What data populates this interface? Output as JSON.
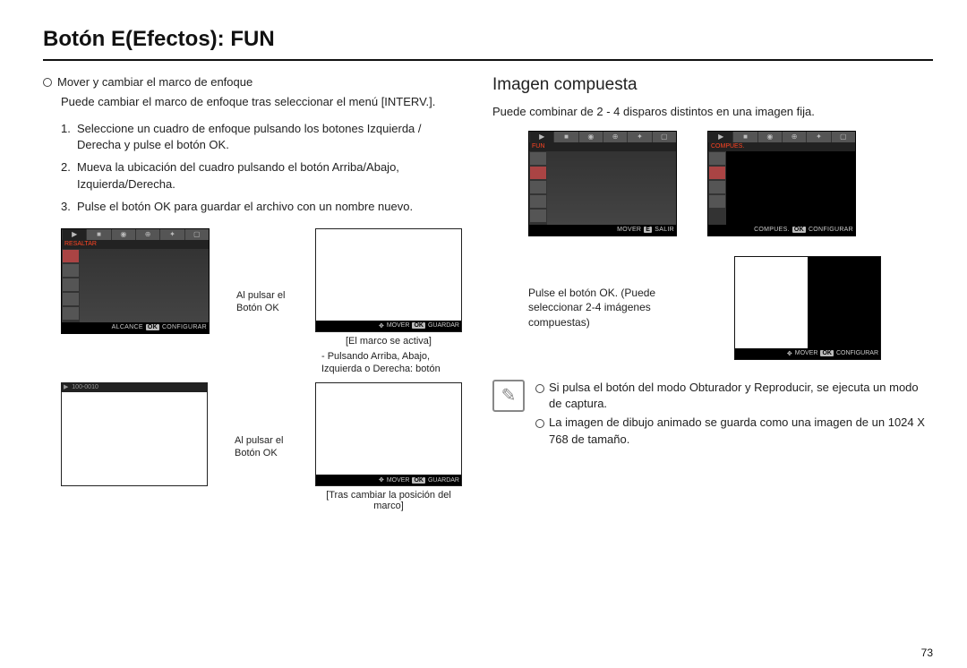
{
  "page": {
    "title": "Botón E(Efectos): FUN",
    "number": "73"
  },
  "left": {
    "lead": "Mover y cambiar el marco de enfoque",
    "lead_sub": "Puede cambiar el marco de enfoque tras seleccionar el menú [INTERV.].",
    "steps": [
      "Seleccione un cuadro de enfoque pulsando los botones Izquierda / Derecha y pulse el botón OK.",
      "Mueva la ubicación del cuadro pulsando el botón Arriba/Abajo, Izquierda/Derecha.",
      "Pulse el botón OK para guardar el archivo con un nombre nuevo."
    ],
    "menu1": {
      "label": "RESALTAR",
      "foot_left": "ALCANCE",
      "foot_key": "OK",
      "foot_right": "CONFIGURAR"
    },
    "cap_mid1": "Al pulsar el Botón OK",
    "preview1": {
      "foot_nav": "MOVER",
      "foot_key": "OK",
      "foot_right": "GUARDAR"
    },
    "cap_under1": "[El marco se activa]",
    "cap_list": "- Pulsando Arriba, Abajo, Izquierda o Derecha: botón",
    "preview2": {
      "top": "100-0010",
      "foot_nav": "MOVER",
      "foot_key": "OK",
      "foot_right": "GUARDAR"
    },
    "cap_mid2": "Al pulsar el Botón OK",
    "cap_under2": "[Tras cambiar la posición del marco]"
  },
  "right": {
    "title": "Imagen compuesta",
    "intro": "Puede combinar de 2 - 4 disparos distintos en una imagen fija.",
    "menuA": {
      "label": "FUN",
      "foot_nav": "MOVER",
      "foot_key": "E",
      "foot_right": "SALIR"
    },
    "menuB": {
      "label": "COMPUES.",
      "foot_left": "COMPUES.",
      "foot_key": "OK",
      "foot_right": "CONFIGURAR"
    },
    "note": "Pulse el botón OK. (Puede seleccionar 2-4 imágenes compuestas)",
    "compositeC": {
      "foot_nav": "MOVER",
      "foot_key": "OK",
      "foot_right": "CONFIGURAR"
    },
    "info1": "Si pulsa el botón del modo Obturador y Reproducir, se ejecuta un modo de captura.",
    "info2": "La imagen de dibujo animado se guarda como una imagen de un 1024 X 768 de tamaño."
  }
}
